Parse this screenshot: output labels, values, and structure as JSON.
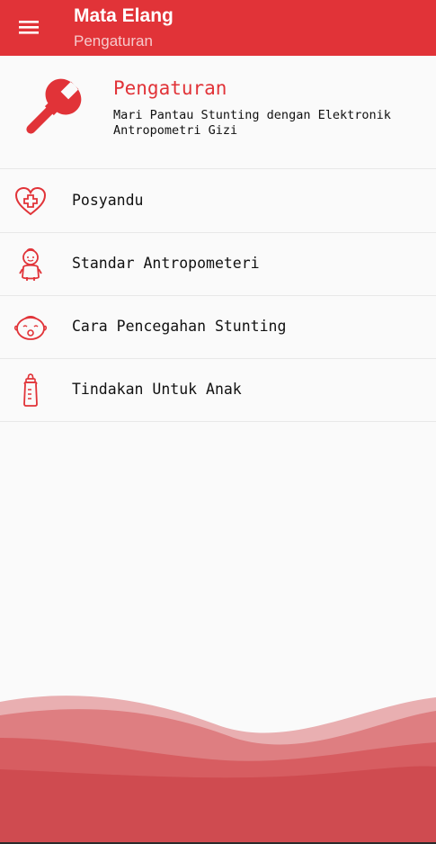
{
  "appbar": {
    "title": "Mata Elang",
    "subtitle": "Pengaturan",
    "icon": "hamburger-menu-icon"
  },
  "header": {
    "title": "Pengaturan",
    "description": "Mari Pantau Stunting dengan Elektronik Antropometri Gizi",
    "icon": "wrench-icon"
  },
  "menu": {
    "items": [
      {
        "label": "Posyandu",
        "icon": "heart-plus-icon"
      },
      {
        "label": "Standar Antropometeri",
        "icon": "baby-icon"
      },
      {
        "label": "Cara Pencegahan Stunting",
        "icon": "baby-face-icon"
      },
      {
        "label": "Tindakan Untuk Anak",
        "icon": "baby-bottle-icon"
      }
    ]
  },
  "colors": {
    "primary": "#e13338",
    "wave": "#d55559"
  }
}
